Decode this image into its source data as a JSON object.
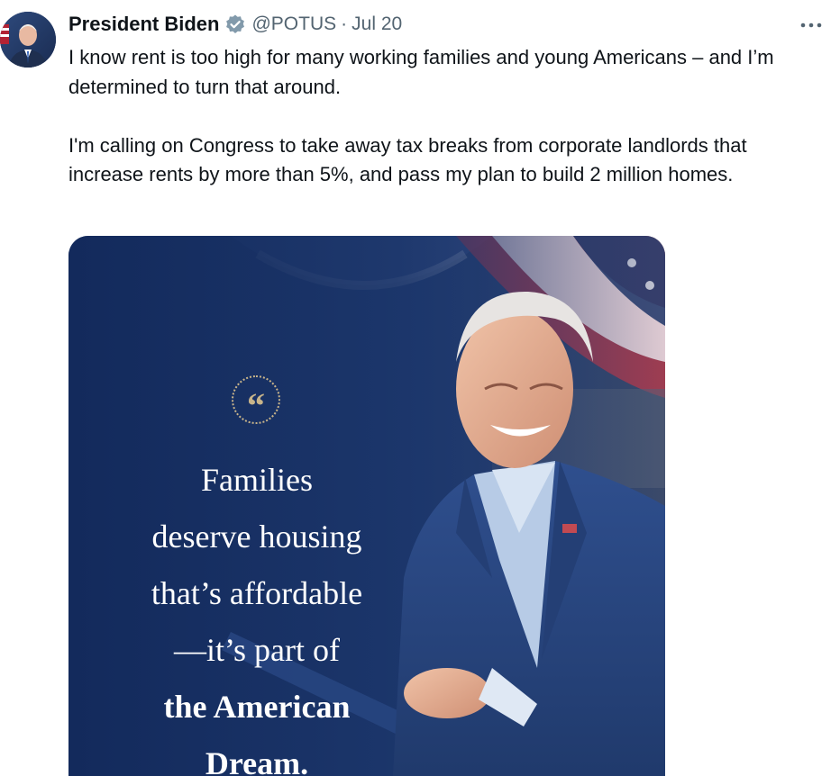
{
  "tweet": {
    "author_name": "President Biden",
    "handle": "@POTUS",
    "separator": "·",
    "date": "Jul 20",
    "paragraph_1": "I know rent is too high for many working families and young Americans – and I’m determined to turn that around.",
    "paragraph_2": "I'm calling on Congress to take away tax breaks from corporate landlords that increase rents by more than 5%, and pass my plan to build 2 million homes."
  },
  "media": {
    "quote_mark": "“",
    "quote_lines": [
      "Families",
      "deserve housing",
      "that’s affordable",
      "—it’s part of",
      "the American",
      "Dream."
    ]
  },
  "icons": {
    "verified": "verified-badge-icon",
    "more": "more-options-icon"
  },
  "colors": {
    "text": "#0f1419",
    "secondary": "#536471",
    "verified_badge": "#829aab",
    "media_navy": "#1b3566"
  }
}
